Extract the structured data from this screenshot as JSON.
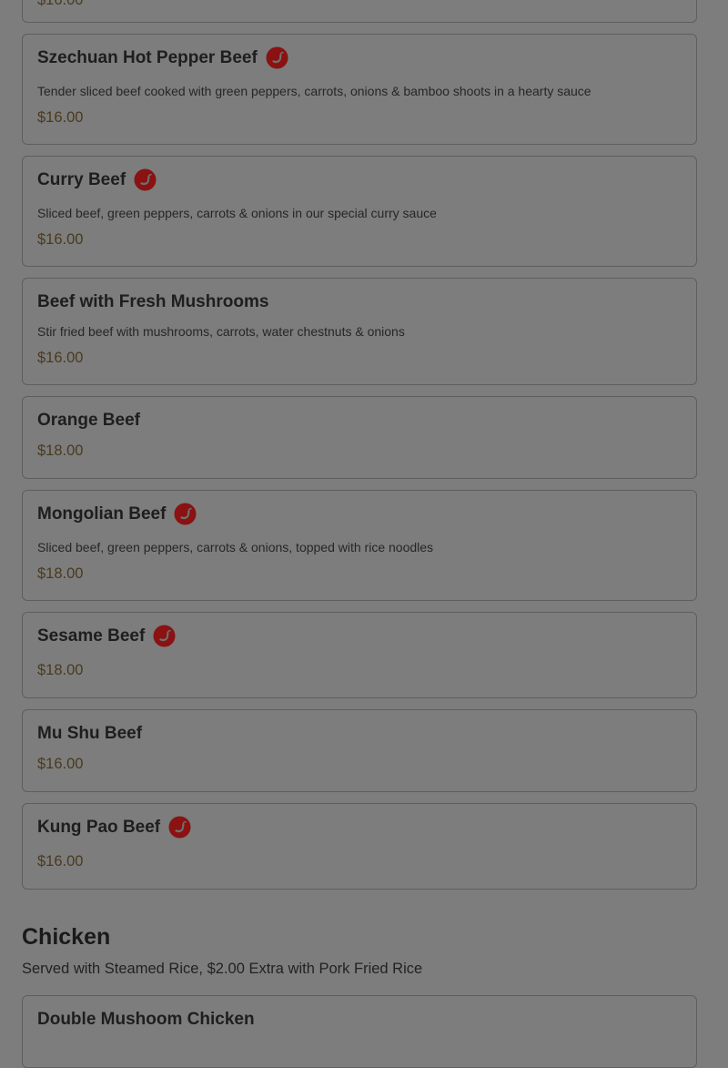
{
  "colors": {
    "overlay_bg": "#7d7d7d",
    "spicy_icon": "#8a1212",
    "price": "#4a3a1e"
  },
  "top_partial_price": "$16.00",
  "beef_items": [
    {
      "name": "Szechuan Hot Pepper Beef",
      "spicy": true,
      "description": "Tender sliced beef cooked with green peppers, carrots, onions & bamboo shoots in a hearty sauce",
      "price": "$16.00"
    },
    {
      "name": "Curry Beef",
      "spicy": true,
      "description": "Sliced beef, green peppers, carrots & onions in our special curry sauce",
      "price": "$16.00"
    },
    {
      "name": "Beef with Fresh Mushrooms",
      "spicy": false,
      "description": "Stir fried beef with mushrooms, carrots, water chestnuts & onions",
      "price": "$16.00"
    },
    {
      "name": "Orange Beef",
      "spicy": false,
      "description": "",
      "price": "$18.00"
    },
    {
      "name": "Mongolian Beef",
      "spicy": true,
      "description": "Sliced beef, green peppers, carrots & onions, topped with rice noodles",
      "price": "$18.00"
    },
    {
      "name": "Sesame Beef",
      "spicy": true,
      "description": "",
      "price": "$18.00"
    },
    {
      "name": "Mu Shu Beef",
      "spicy": false,
      "description": "",
      "price": "$16.00"
    },
    {
      "name": "Kung Pao Beef",
      "spicy": true,
      "description": "",
      "price": "$16.00"
    }
  ],
  "chicken_section": {
    "title": "Chicken",
    "subtitle": "Served with Steamed Rice, $2.00 Extra with Pork Fried Rice",
    "first_item": "Double Mushoom Chicken"
  }
}
